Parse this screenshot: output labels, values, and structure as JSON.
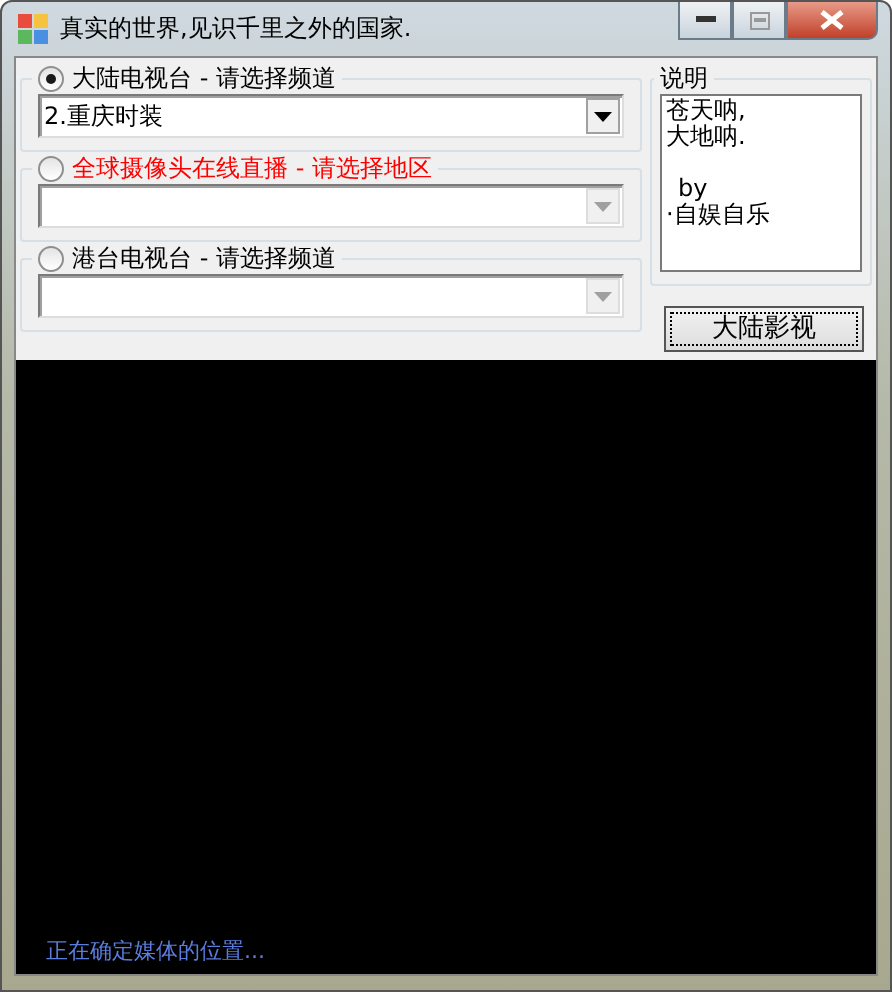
{
  "window": {
    "title": "真实的世界,见识千里之外的国家."
  },
  "groups": [
    {
      "label": "大陆电视台 - 请选择频道",
      "selected": true,
      "color": "#000000",
      "combo": {
        "value": "2.重庆时装",
        "disabled": false
      }
    },
    {
      "label": "全球摄像头在线直播 - 请选择地区",
      "selected": false,
      "color": "#ff0000",
      "combo": {
        "disabled": true
      }
    },
    {
      "label": "港台电视台 - 请选择频道",
      "selected": false,
      "color": "#000000",
      "combo": {
        "disabled": true
      }
    }
  ],
  "notes": {
    "title": "说明",
    "lines": [
      {
        "text": "苍天呐,",
        "gap_before": false,
        "indent": false
      },
      {
        "text": "大地呐.",
        "gap_before": false,
        "indent": false
      },
      {
        "text": "by",
        "gap_before": true,
        "indent": true
      },
      {
        "text": "·自娱自乐",
        "gap_before": false,
        "indent": false
      }
    ]
  },
  "button": "大陆影视",
  "status": "正在确定媒体的位置..."
}
